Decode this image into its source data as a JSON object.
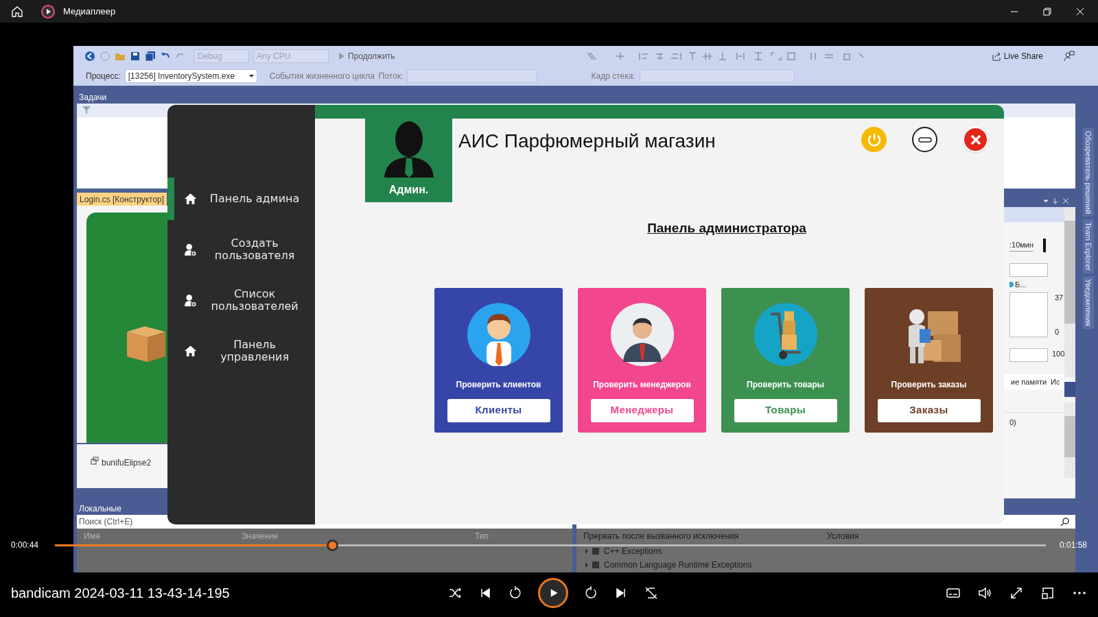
{
  "player": {
    "title": "Медиаплеер",
    "video_title": "bandicam 2024-03-11 13-43-14-195",
    "elapsed": "0:00:44",
    "duration": "0:01:58",
    "level": 0.28,
    "playing": false
  },
  "ide": {
    "toolbar": {
      "config": "Debug",
      "platform": "Any CPU",
      "continue": "Продолжить",
      "live_share": "Live Share",
      "process_label": "Процесс:",
      "process": "[13256] InventorySystem.exe",
      "lifecycle": "События жизненного цикла",
      "thread_label": "Поток:",
      "stack_label": "Кадр стека:"
    },
    "tasks_panel": "Задачи",
    "designer_tab": "Login.cs [Конструктор]",
    "component": "bunifuElipse2",
    "side_tabs": [
      "Обозреватель решений",
      "Team Explorer",
      "Уведомления"
    ],
    "diagnostics": {
      "timeline": ":10мин",
      "legend": "Б...",
      "max": "37",
      "min": "0",
      "memory_max": "100",
      "tab": "ие памяти",
      "tab_2": "Ис",
      "row": "0)"
    },
    "locals": {
      "title": "Локальные",
      "search_placeholder": "Поиск (Ctrl+E)",
      "columns": [
        "Имя",
        "Значение",
        "Тип"
      ]
    },
    "exceptions": {
      "columns": [
        "Прервать после вызванного исключения",
        "Условия"
      ],
      "rows": [
        "C++ Exceptions",
        "Common Language Runtime Exceptions"
      ]
    }
  },
  "app": {
    "avatar_label": "Админ.",
    "title": "АИС Парфюмерный магазин",
    "heading": "Панель администратора",
    "menu": [
      {
        "label": "Панель админа",
        "kind": "home",
        "selected": true
      },
      {
        "label": "Создать пользователя",
        "kind": "user",
        "selected": false
      },
      {
        "label": "Список пользователей",
        "kind": "user",
        "selected": false
      },
      {
        "label": "Панель управления",
        "kind": "home",
        "selected": false
      }
    ],
    "cards": [
      {
        "caption": "Проверить клиентов",
        "button": "Клиенты",
        "color": "#3646a8",
        "kind": "client"
      },
      {
        "caption": "Проверить менеджеров",
        "button": "Менеджеры",
        "color": "#f2468f",
        "kind": "manager"
      },
      {
        "caption": "Проверить товары",
        "button": "Товары",
        "color": "#3d9150",
        "kind": "goods"
      },
      {
        "caption": "Проверить заказы",
        "button": "Заказы",
        "color": "#6d3f26",
        "kind": "orders"
      }
    ]
  }
}
